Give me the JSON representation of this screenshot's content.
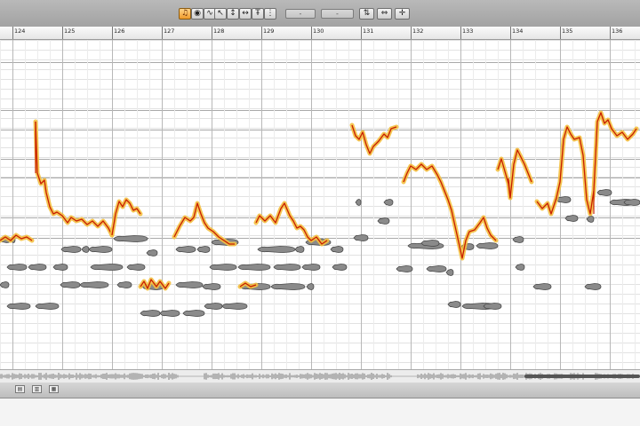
{
  "toolbar": {
    "modes": [
      "note",
      "pitch",
      "formant"
    ],
    "tools": [
      "pointer",
      "pitch-tool",
      "timing-tool",
      "amplitude-tool",
      "separation-tool"
    ],
    "fields": [
      "-",
      "-"
    ],
    "extras": [
      "scale-snap",
      "quantize",
      "split"
    ]
  },
  "ruler": {
    "bars": [
      "124",
      "125",
      "126",
      "127",
      "128",
      "129",
      "130",
      "131",
      "132",
      "133",
      "134",
      "135",
      "136"
    ]
  },
  "colors": {
    "accent_orange": "#f0a030",
    "pitch_line": "#c81e00",
    "blob_gray": "#8a8a8a",
    "grid_line": "#cfcfcf"
  },
  "status": {
    "buttons": [
      "a",
      "b",
      "c"
    ]
  }
}
